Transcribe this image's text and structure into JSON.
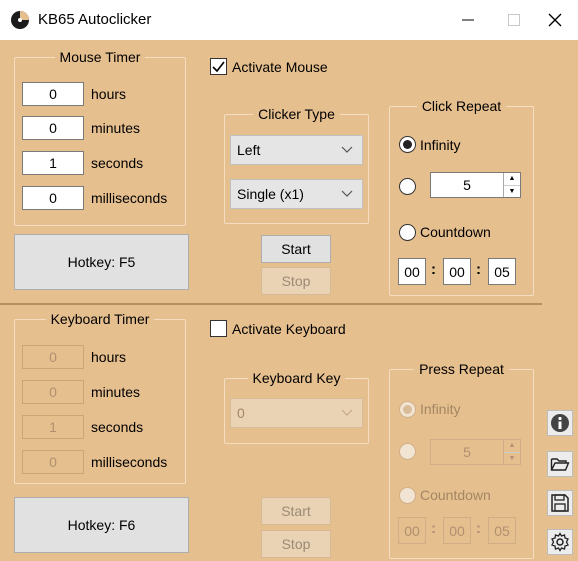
{
  "window": {
    "title": "KB65 Autoclicker"
  },
  "mouse": {
    "timer_title": "Mouse Timer",
    "timer": [
      {
        "value": "0",
        "label": "hours"
      },
      {
        "value": "0",
        "label": "minutes"
      },
      {
        "value": "1",
        "label": "seconds"
      },
      {
        "value": "0",
        "label": "milliseconds"
      }
    ],
    "hotkey": "Hotkey: F5",
    "activate_label": "Activate Mouse",
    "clicker_type_title": "Clicker Type",
    "button_select": "Left",
    "click_select": "Single (x1)",
    "start": "Start",
    "stop": "Stop",
    "repeat_title": "Click Repeat",
    "infinity": "Infinity",
    "repeat_count": "5",
    "countdown": "Countdown",
    "countdown_time": [
      "00",
      "00",
      "05"
    ]
  },
  "keyboard": {
    "timer_title": "Keyboard Timer",
    "timer": [
      {
        "value": "0",
        "label": "hours"
      },
      {
        "value": "0",
        "label": "minutes"
      },
      {
        "value": "1",
        "label": "seconds"
      },
      {
        "value": "0",
        "label": "milliseconds"
      }
    ],
    "hotkey": "Hotkey: F6",
    "activate_label": "Activate Keyboard",
    "key_title": "Keyboard Key",
    "key_select": "0",
    "start": "Start",
    "stop": "Stop",
    "repeat_title": "Press Repeat",
    "infinity": "Infinity",
    "repeat_count": "5",
    "countdown": "Countdown",
    "countdown_time": [
      "00",
      "00",
      "05"
    ]
  },
  "side_icons": [
    "info-icon",
    "folder-open-icon",
    "save-icon",
    "settings-gear-icon"
  ],
  "colors": {
    "background": "#e6bf8f",
    "divider": "#b58f62"
  }
}
